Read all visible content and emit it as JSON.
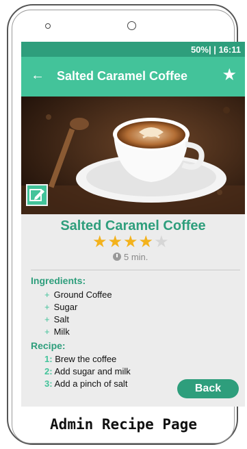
{
  "status_bar": {
    "text": "50%| | 16:11"
  },
  "app_bar": {
    "back_icon": "back-arrow-icon",
    "title": "Salted Caramel Coffee",
    "favorite_icon": "star-icon"
  },
  "recipe": {
    "title": "Salted Caramel Coffee",
    "rating": 4,
    "rating_max": 5,
    "time": "5 min.",
    "ingredients_heading": "Ingredients:",
    "ingredients": [
      {
        "marker": "+",
        "text": "Ground Coffee"
      },
      {
        "marker": "+",
        "text": "Sugar"
      },
      {
        "marker": "+",
        "text": "Salt"
      },
      {
        "marker": "+",
        "text": "Milk"
      }
    ],
    "recipe_heading": "Recipe:",
    "steps": [
      {
        "num": "1:",
        "text": "Brew the coffee"
      },
      {
        "num": "2:",
        "text": "Add sugar and milk"
      },
      {
        "num": "3:",
        "text": "Add a pinch of salt"
      }
    ]
  },
  "back_button": {
    "label": "Back"
  },
  "caption": "Admin Recipe Page",
  "colors": {
    "primary": "#43c39a",
    "primary_dark": "#2e9e7c",
    "star": "#f3b21c",
    "background": "#ececec"
  }
}
